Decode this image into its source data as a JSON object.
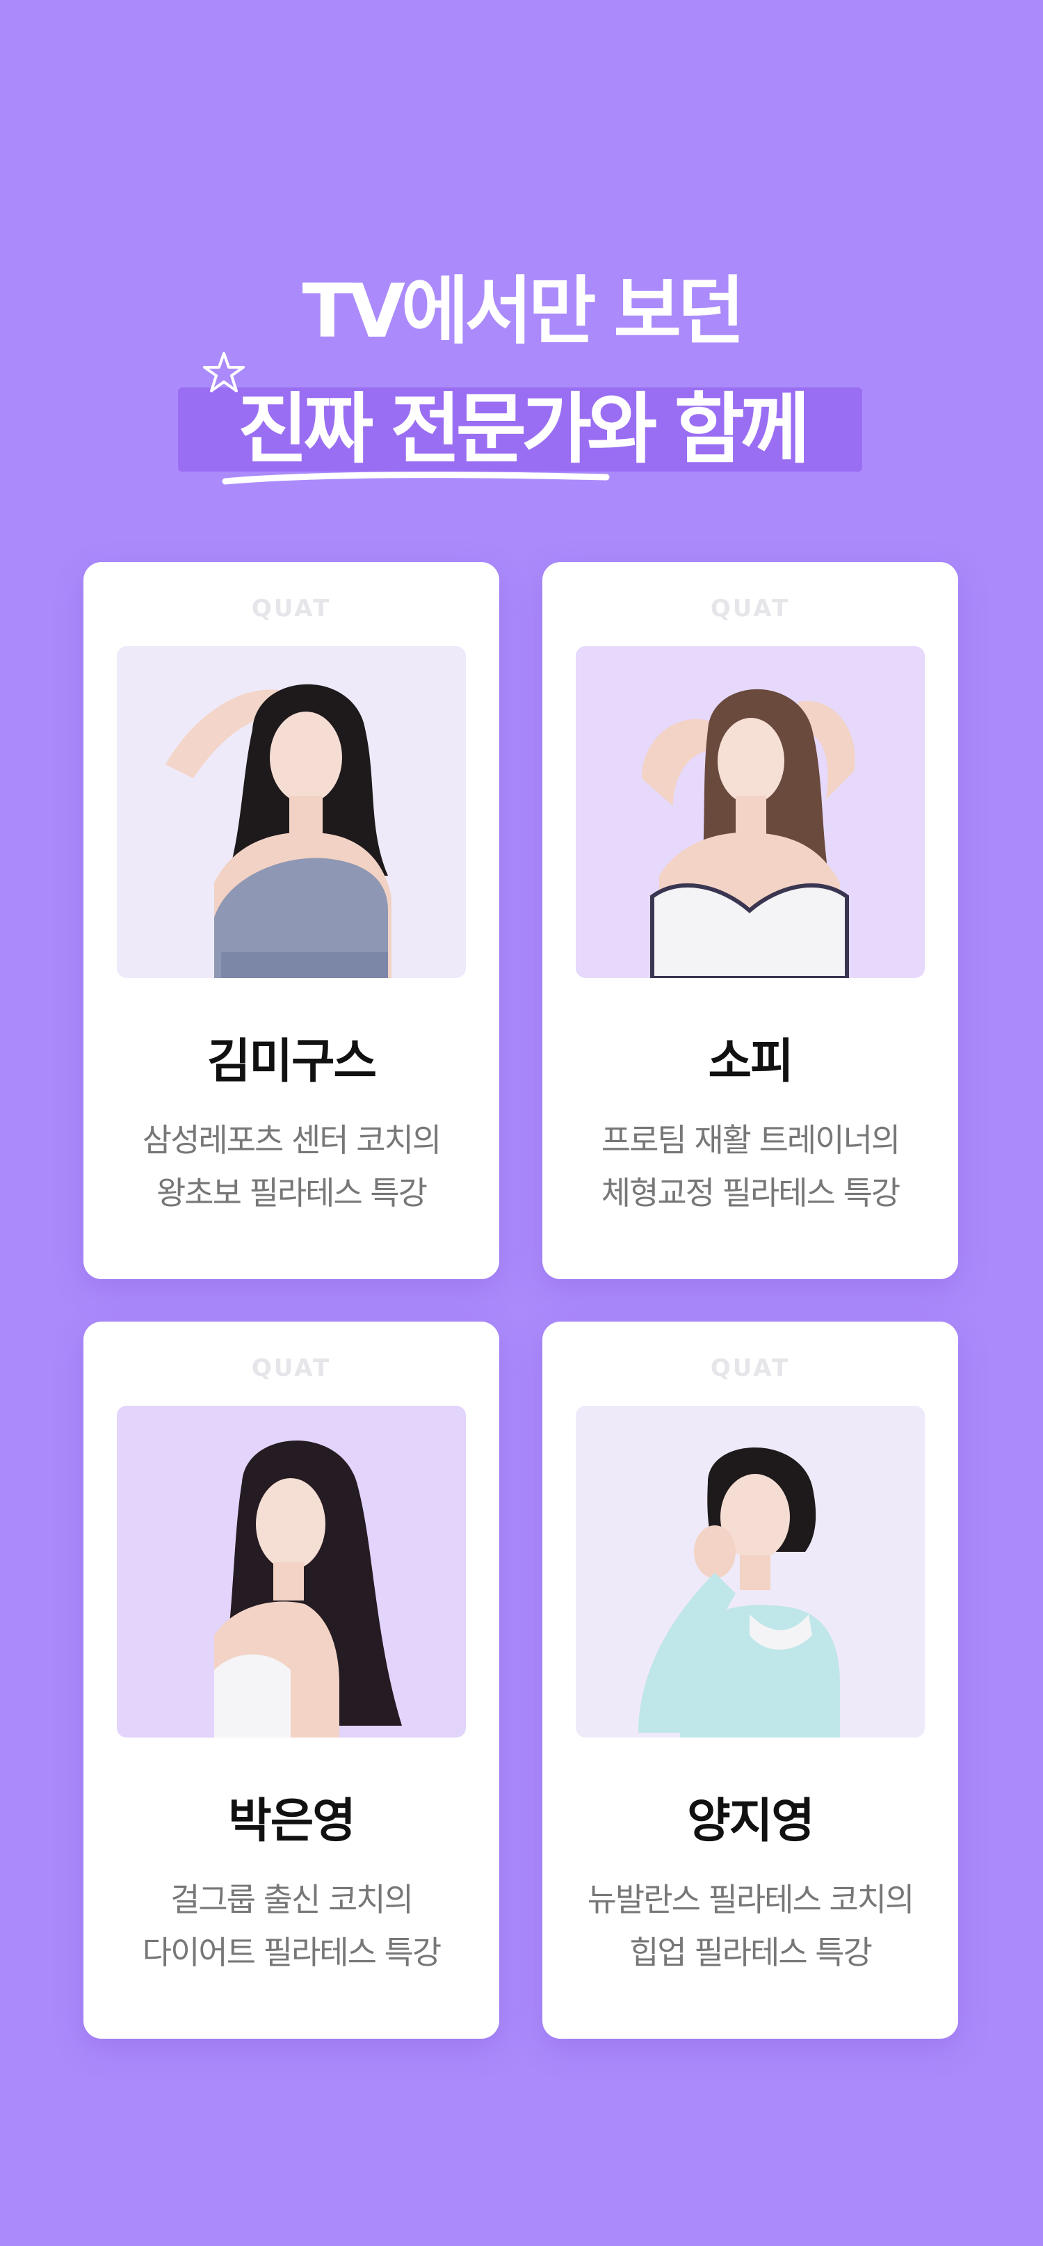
{
  "header": {
    "line1": "TV에서만 보던",
    "line2": "진짜 전문가와 함께"
  },
  "brand": "QUAT",
  "colors": {
    "background": "#AB8BFB",
    "highlight": "#9A6EF2",
    "card": "#FFFFFF",
    "name_text": "#111111",
    "desc_text": "#777777"
  },
  "coaches": [
    {
      "name": "김미구스",
      "desc_line1": "삼성레포츠 센터 코치의",
      "desc_line2": "왕초보 필라테스 특강",
      "photo": "coach-photo-kim-migus"
    },
    {
      "name": "소피",
      "desc_line1": "프로팀 재활 트레이너의",
      "desc_line2": "체형교정 필라테스 특강",
      "photo": "coach-photo-sophie"
    },
    {
      "name": "박은영",
      "desc_line1": "걸그룹 출신 코치의",
      "desc_line2": "다이어트 필라테스 특강",
      "photo": "coach-photo-park-eunyoung"
    },
    {
      "name": "양지영",
      "desc_line1": "뉴발란스 필라테스 코치의",
      "desc_line2": "힙업 필라테스 특강",
      "photo": "coach-photo-yang-jiyoung"
    }
  ]
}
